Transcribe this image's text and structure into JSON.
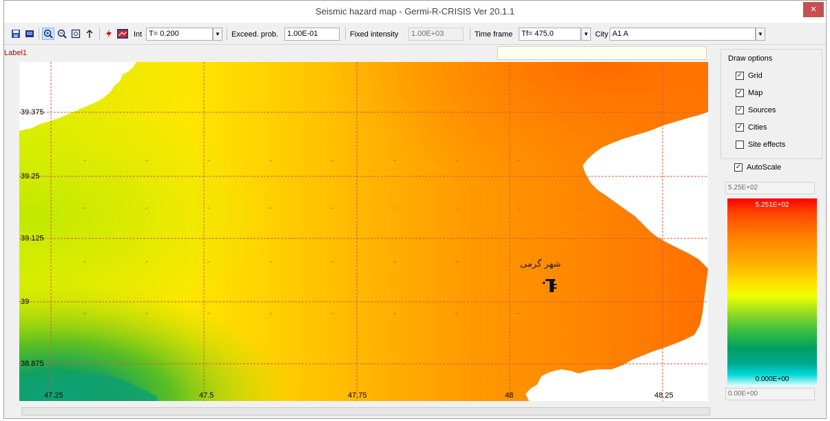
{
  "window": {
    "title": "Seismic hazard map - Germi-R-CRISIS Ver 20.1.1",
    "close_glyph": "×"
  },
  "toolbar": {
    "icons": [
      "save-icon",
      "display-icon",
      "zoom-in-icon",
      "zoom-out-icon",
      "zoom-fit-icon",
      "up-arrow-icon",
      "lightning-icon",
      "map-color-icon"
    ],
    "int_label": "Int",
    "int_value": "T= 0.200",
    "exceed_label": "Exceed. prob.",
    "exceed_value": "1.00E-01",
    "fixed_label": "Fixed intensity",
    "fixed_value": "1.00E+03",
    "timeframe_label": "Time frame",
    "timeframe_value": "Tf= 475.0",
    "city_label": "City",
    "city_value": "A1 A"
  },
  "label1": "Label1",
  "map": {
    "lat_labels": [
      "39.375",
      "39.25",
      "39.125",
      "39",
      "38.875"
    ],
    "lon_labels": [
      "47.25",
      "47.5",
      "47.75",
      "48",
      "48.25"
    ],
    "city_name": "شهر گرمی",
    "city_icon": "city-marker-icon",
    "colors": {
      "grid": "#d05a3a",
      "land_high": "#ff7a00",
      "land_mid": "#ffd000",
      "land_low": "#00a890",
      "sea": "#ffffff"
    }
  },
  "draw_options": {
    "title": "Draw options",
    "items": [
      {
        "label": "Grid",
        "checked": true
      },
      {
        "label": "Map",
        "checked": true
      },
      {
        "label": "Sources",
        "checked": true
      },
      {
        "label": "Cities",
        "checked": true
      },
      {
        "label": "Site effects",
        "checked": false
      }
    ]
  },
  "autoscale": {
    "label": "AutoScale",
    "checked": true
  },
  "colorbar": {
    "max_field": "5.25E+02",
    "min_field": "0.00E+00",
    "max_label": "5.251E+02",
    "min_label": "0.000E+00"
  }
}
